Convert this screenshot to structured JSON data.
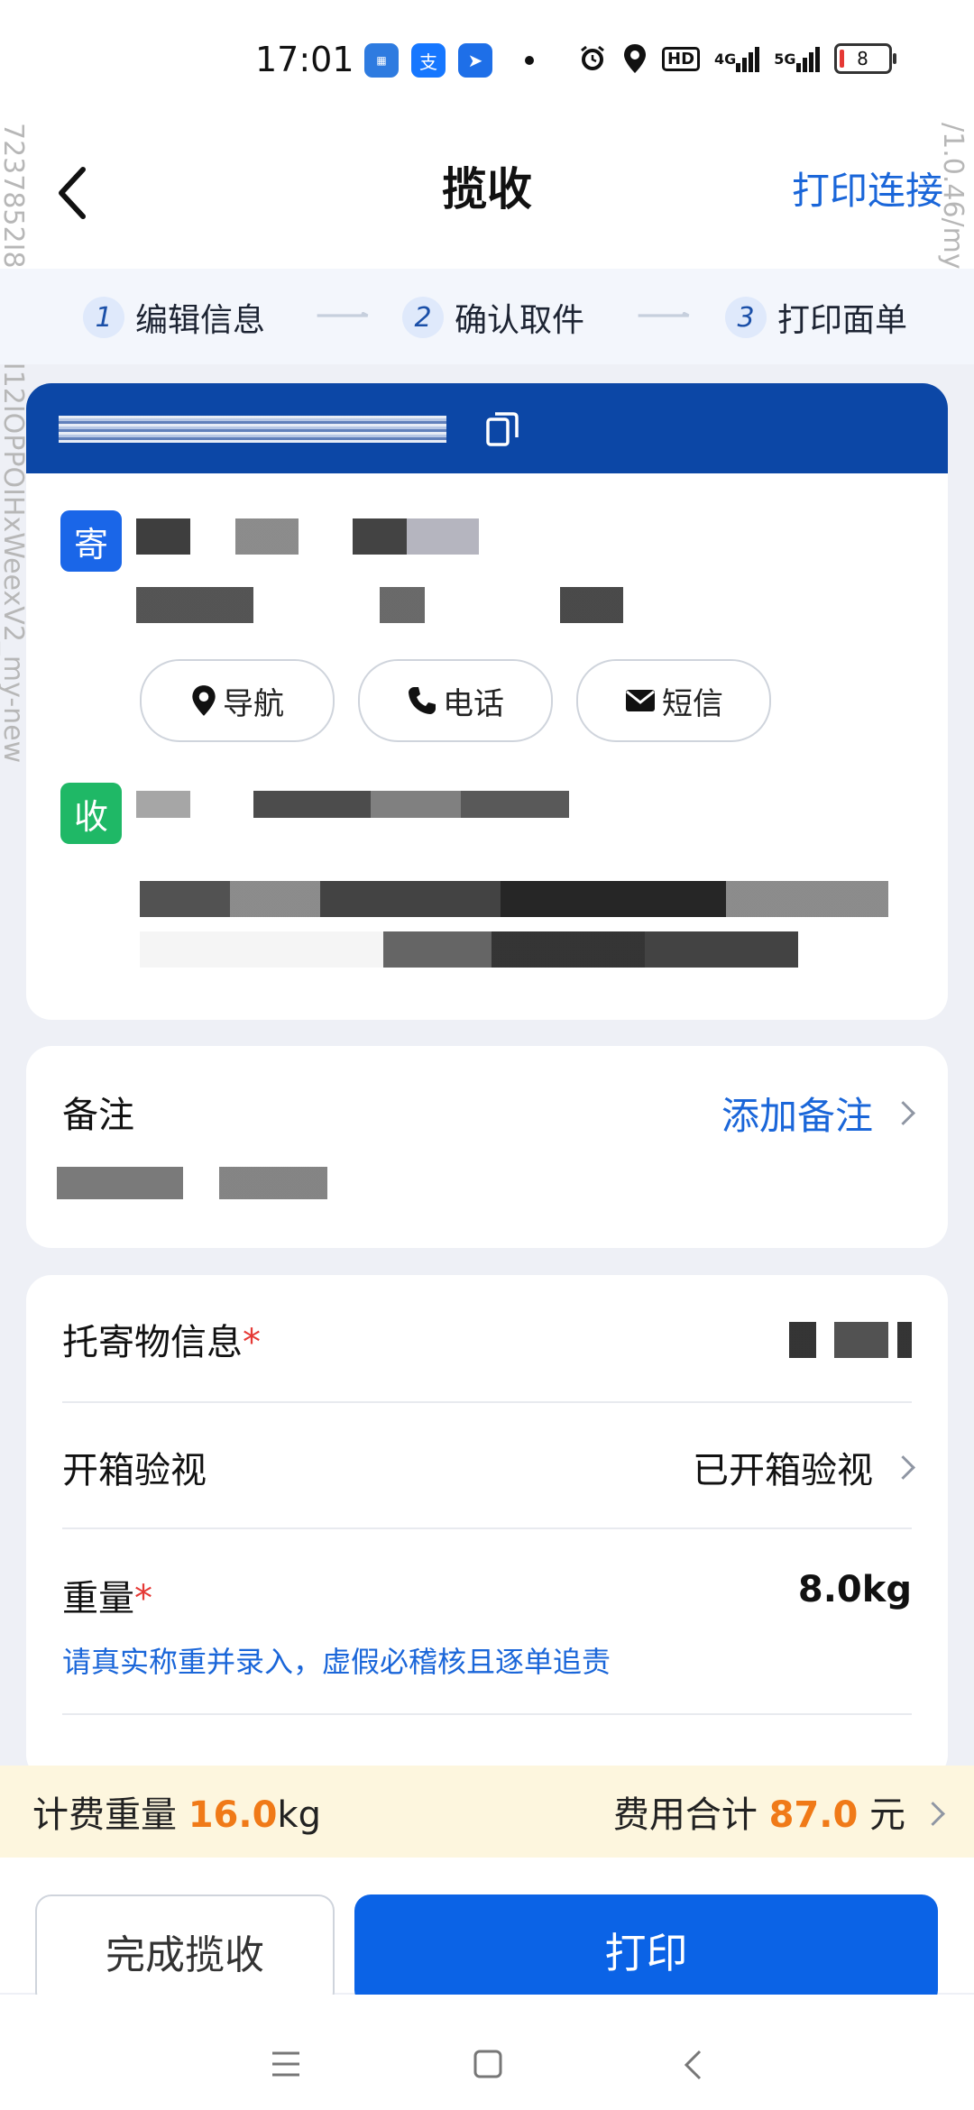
{
  "status_bar": {
    "time": "17:01",
    "apps": [
      "mini-program-icon",
      "alipay-icon",
      "app-icon"
    ],
    "network": "4G",
    "network2": "5G",
    "hd_label": "HD",
    "battery": "8"
  },
  "header": {
    "title": "揽收",
    "right_action": "打印连接"
  },
  "watermark": {
    "left": "7237852I8I7.77.2I12IOPPOIHxWeexV2_my-new",
    "right": "/1.0.46/my-new"
  },
  "steps": [
    {
      "num": "1",
      "label": "编辑信息"
    },
    {
      "num": "2",
      "label": "确认取件"
    },
    {
      "num": "3",
      "label": "打印面单"
    }
  ],
  "parcel": {
    "sender_badge": "寄",
    "receiver_badge": "收",
    "actions": [
      {
        "icon": "location-pin-icon",
        "label": "导航"
      },
      {
        "icon": "phone-icon",
        "label": "电话"
      },
      {
        "icon": "envelope-icon",
        "label": "短信"
      }
    ]
  },
  "remark": {
    "label": "备注",
    "action": "添加备注"
  },
  "goods": {
    "item_info_label": "托寄物信息",
    "required_mark": "*",
    "inspection_label": "开箱验视",
    "inspection_value": "已开箱验视",
    "weight_label": "重量",
    "weight_value": "8.0kg",
    "weight_hint": "请真实称重并录入，虚假必稽核且逐单追责"
  },
  "fee": {
    "billing_weight_label": "计费重量",
    "billing_weight_value": "16.0",
    "billing_weight_unit": "kg",
    "total_label": "费用合计",
    "total_value": "87.0",
    "total_unit": "元"
  },
  "footer": {
    "complete_label": "完成揽收",
    "print_label": "打印"
  },
  "colors": {
    "primary": "#0b63e6",
    "header_blue": "#0c47a6",
    "accent_orange": "#f07a18",
    "link_blue": "#1a66d9",
    "sender_badge": "#1a66e8",
    "receiver_badge": "#1fb866"
  }
}
